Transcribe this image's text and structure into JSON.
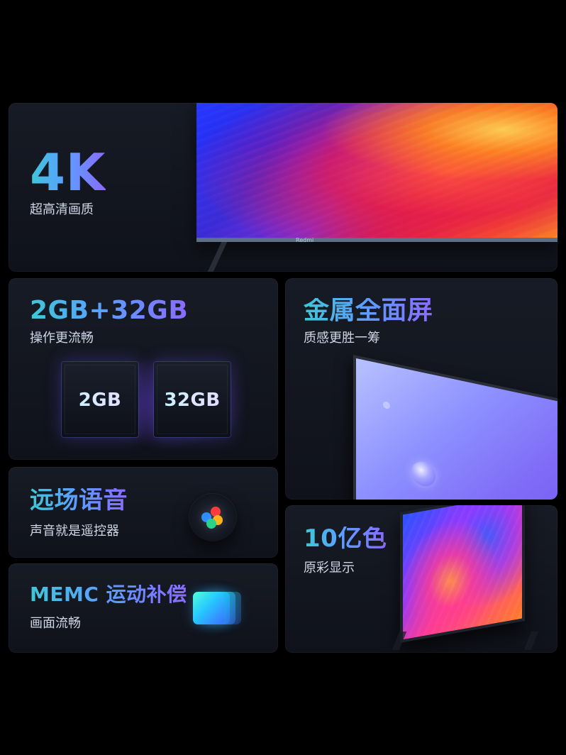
{
  "cards": {
    "hero": {
      "title": "4K",
      "subtitle": "超高清画质",
      "brand": "Redmi"
    },
    "memory": {
      "title": "2GB+32GB",
      "subtitle": "操作更流畅",
      "chips": [
        {
          "label": "2GB"
        },
        {
          "label": "32GB"
        }
      ]
    },
    "metal": {
      "title": "金属全面屏",
      "subtitle": "质感更胜一筹"
    },
    "voice": {
      "title": "远场语音",
      "subtitle": "声音就是遥控器"
    },
    "memc": {
      "title": "MEMC 运动补偿",
      "subtitle": "画面流畅"
    },
    "color": {
      "title": "10亿色",
      "subtitle": "原彩显示"
    }
  },
  "colors": {
    "background": "#000000",
    "card": "#141821",
    "text": "#ffffff",
    "subtext": "#cfd6e6",
    "title_gradient": [
      "#3fc7d6",
      "#5aa0ff",
      "#8a6bff"
    ]
  },
  "icons": {
    "voice": "voice-assistant-icon",
    "memc": "stacked-frames-icon"
  }
}
